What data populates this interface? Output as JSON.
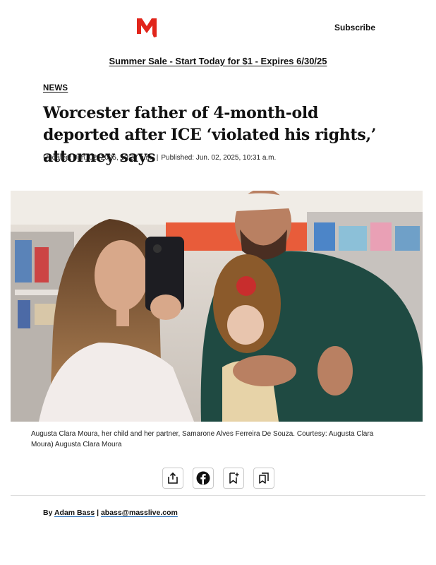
{
  "header": {
    "logo_letter": "M",
    "brand_color": "#e1251b",
    "subscribe_label": "Subscribe"
  },
  "promo": {
    "text": "Summer Sale - Start Today for $1 - Expires 6/30/25"
  },
  "article": {
    "section": "NEWS",
    "headline": "Worcester father of 4-month-old deported after ICE ‘violated his rights,’ attorney says",
    "updated": "Updated: Jun. 02, 2025, 10:37 a.m.",
    "separator": "|",
    "published": "Published: Jun. 02, 2025, 10:31 a.m.",
    "caption": "Augusta Clara Moura, her child and her partner, Samarone Alves Ferreira De Souza. Courtesy: Augusta Clara Moura)  Augusta Clara Moura"
  },
  "share": {
    "icons": [
      "share-icon",
      "facebook-icon",
      "bookmark-add-icon",
      "saved-list-icon"
    ]
  },
  "byline": {
    "prefix": "By",
    "author": "Adam Bass",
    "separator": "|",
    "email": "abass@masslive.com"
  }
}
